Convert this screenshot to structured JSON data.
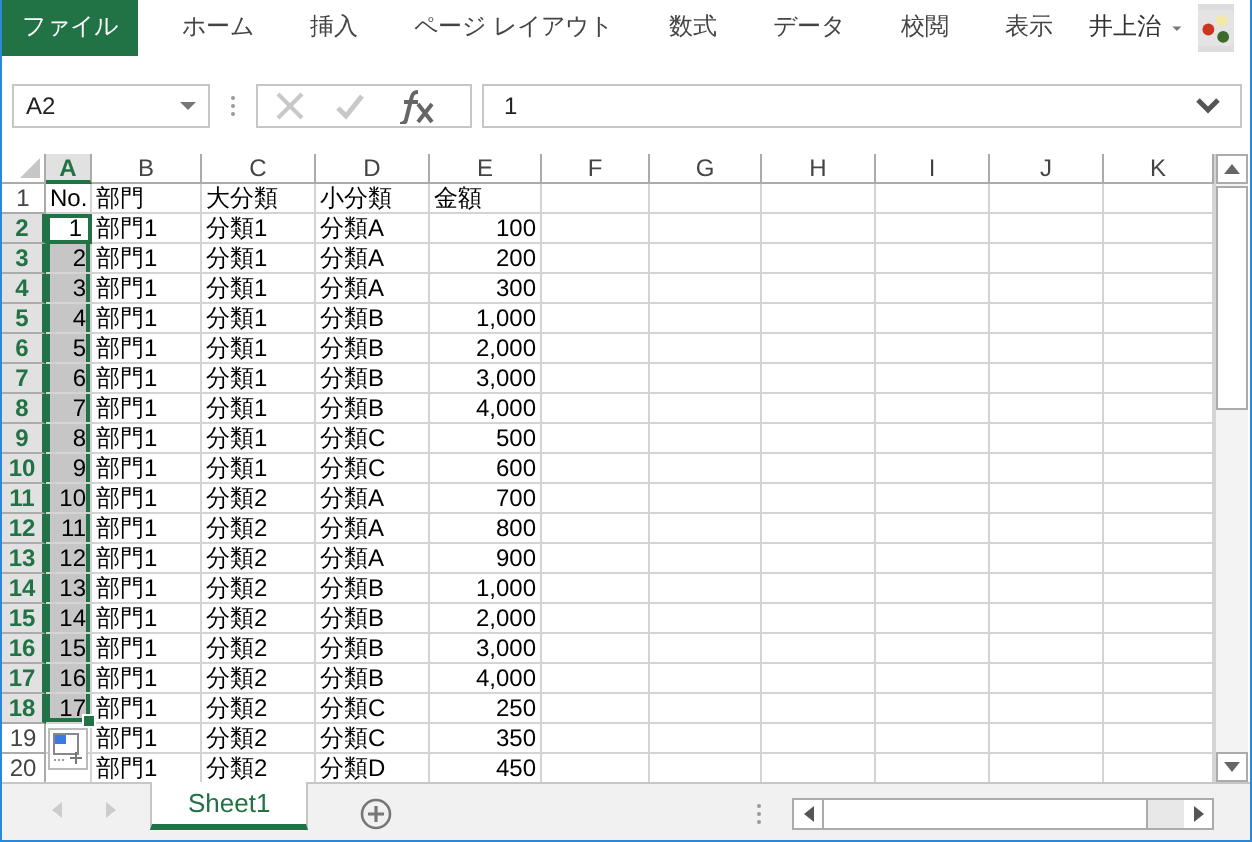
{
  "ribbon": {
    "tabs": [
      {
        "label": "ファイル",
        "kind": "file",
        "selected": false
      },
      {
        "label": "ホーム",
        "kind": "tab",
        "selected": false
      },
      {
        "label": "挿入",
        "kind": "tab",
        "selected": false
      },
      {
        "label": "ページ レイアウト",
        "kind": "tab",
        "selected": false
      },
      {
        "label": "数式",
        "kind": "tab",
        "selected": false
      },
      {
        "label": "データ",
        "kind": "tab",
        "selected": false
      },
      {
        "label": "校閲",
        "kind": "tab",
        "selected": false
      },
      {
        "label": "表示",
        "kind": "tab",
        "selected": false
      }
    ],
    "user": "井上治"
  },
  "formula_bar": {
    "name_box": "A2",
    "value": "1"
  },
  "grid": {
    "columns": [
      {
        "label": "A",
        "selected": true
      },
      {
        "label": "B",
        "selected": false
      },
      {
        "label": "C",
        "selected": false
      },
      {
        "label": "D",
        "selected": false
      },
      {
        "label": "E",
        "selected": false
      },
      {
        "label": "F",
        "selected": false
      },
      {
        "label": "G",
        "selected": false
      },
      {
        "label": "H",
        "selected": false
      },
      {
        "label": "I",
        "selected": false
      },
      {
        "label": "J",
        "selected": false
      },
      {
        "label": "K",
        "selected": false
      }
    ],
    "rows": [
      {
        "header": "1",
        "selected": false,
        "active": false,
        "cells": [
          "No.",
          "部門",
          "大分類",
          "小分類",
          "金額"
        ]
      },
      {
        "header": "2",
        "selected": true,
        "active": true,
        "cells": [
          "1",
          "部門1",
          "分類1",
          "分類A",
          "100"
        ]
      },
      {
        "header": "3",
        "selected": true,
        "active": false,
        "cells": [
          "2",
          "部門1",
          "分類1",
          "分類A",
          "200"
        ]
      },
      {
        "header": "4",
        "selected": true,
        "active": false,
        "cells": [
          "3",
          "部門1",
          "分類1",
          "分類A",
          "300"
        ]
      },
      {
        "header": "5",
        "selected": true,
        "active": false,
        "cells": [
          "4",
          "部門1",
          "分類1",
          "分類B",
          "1,000"
        ]
      },
      {
        "header": "6",
        "selected": true,
        "active": false,
        "cells": [
          "5",
          "部門1",
          "分類1",
          "分類B",
          "2,000"
        ]
      },
      {
        "header": "7",
        "selected": true,
        "active": false,
        "cells": [
          "6",
          "部門1",
          "分類1",
          "分類B",
          "3,000"
        ]
      },
      {
        "header": "8",
        "selected": true,
        "active": false,
        "cells": [
          "7",
          "部門1",
          "分類1",
          "分類B",
          "4,000"
        ]
      },
      {
        "header": "9",
        "selected": true,
        "active": false,
        "cells": [
          "8",
          "部門1",
          "分類1",
          "分類C",
          "500"
        ]
      },
      {
        "header": "10",
        "selected": true,
        "active": false,
        "cells": [
          "9",
          "部門1",
          "分類1",
          "分類C",
          "600"
        ]
      },
      {
        "header": "11",
        "selected": true,
        "active": false,
        "cells": [
          "10",
          "部門1",
          "分類2",
          "分類A",
          "700"
        ]
      },
      {
        "header": "12",
        "selected": true,
        "active": false,
        "cells": [
          "11",
          "部門1",
          "分類2",
          "分類A",
          "800"
        ]
      },
      {
        "header": "13",
        "selected": true,
        "active": false,
        "cells": [
          "12",
          "部門1",
          "分類2",
          "分類A",
          "900"
        ]
      },
      {
        "header": "14",
        "selected": true,
        "active": false,
        "cells": [
          "13",
          "部門1",
          "分類2",
          "分類B",
          "1,000"
        ]
      },
      {
        "header": "15",
        "selected": true,
        "active": false,
        "cells": [
          "14",
          "部門1",
          "分類2",
          "分類B",
          "2,000"
        ]
      },
      {
        "header": "16",
        "selected": true,
        "active": false,
        "cells": [
          "15",
          "部門1",
          "分類2",
          "分類B",
          "3,000"
        ]
      },
      {
        "header": "17",
        "selected": true,
        "active": false,
        "cells": [
          "16",
          "部門1",
          "分類2",
          "分類B",
          "4,000"
        ]
      },
      {
        "header": "18",
        "selected": true,
        "active": false,
        "cells": [
          "17",
          "部門1",
          "分類2",
          "分類C",
          "250"
        ]
      },
      {
        "header": "19",
        "selected": false,
        "active": false,
        "cells": [
          null,
          "部門1",
          "分類2",
          "分類C",
          "350"
        ]
      },
      {
        "header": "20",
        "selected": false,
        "active": false,
        "cells": [
          null,
          "部門1",
          "分類2",
          "分類D",
          "450"
        ]
      }
    ]
  },
  "sheet_tabs": [
    {
      "label": "Sheet1",
      "selected": true
    }
  ]
}
